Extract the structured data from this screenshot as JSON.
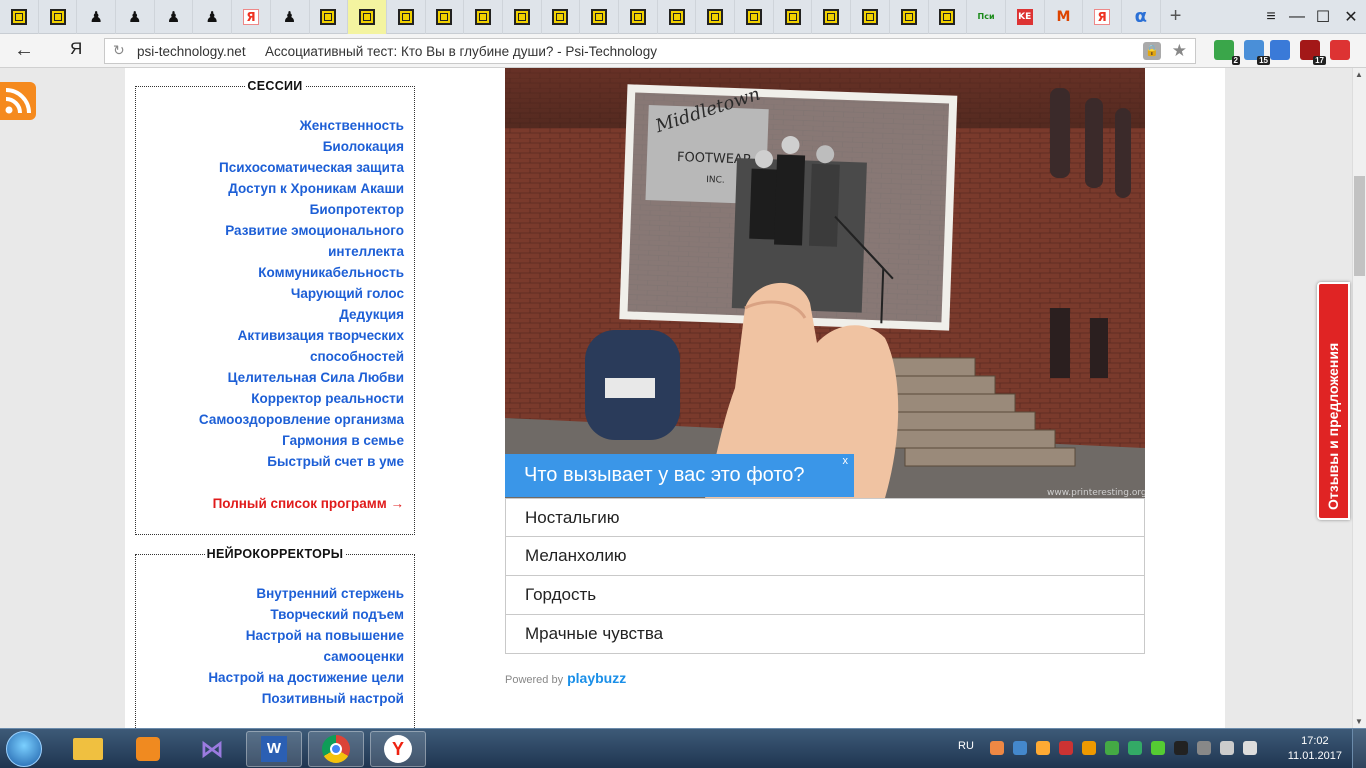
{
  "browser": {
    "tabs": [
      {
        "icon": "maze-icon"
      },
      {
        "icon": "maze-icon"
      },
      {
        "icon": "chess-piece-icon"
      },
      {
        "icon": "chess-piece-icon"
      },
      {
        "icon": "chess-piece-icon"
      },
      {
        "icon": "chess-piece-icon"
      },
      {
        "icon": "yandex-icon",
        "text": "Я"
      },
      {
        "icon": "chess-piece-icon"
      },
      {
        "icon": "maze-icon"
      },
      {
        "icon": "maze-icon",
        "active": true
      },
      {
        "icon": "maze-icon"
      },
      {
        "icon": "maze-icon"
      },
      {
        "icon": "maze-icon"
      },
      {
        "icon": "maze-icon"
      },
      {
        "icon": "maze-icon"
      },
      {
        "icon": "maze-icon"
      },
      {
        "icon": "maze-icon"
      },
      {
        "icon": "maze-icon"
      },
      {
        "icon": "maze-icon"
      },
      {
        "icon": "maze-icon"
      },
      {
        "icon": "maze-icon"
      },
      {
        "icon": "maze-icon"
      },
      {
        "icon": "maze-icon"
      },
      {
        "icon": "maze-icon"
      },
      {
        "icon": "maze-icon"
      },
      {
        "icon": "psi-icon",
        "text": "Пси"
      },
      {
        "icon": "ke-icon",
        "text": "KE"
      },
      {
        "icon": "m-icon",
        "text": "М"
      },
      {
        "icon": "yandex-icon",
        "text": "Я"
      },
      {
        "icon": "alpha-icon",
        "text": "α"
      }
    ],
    "new_tab_symbol": "+",
    "window_controls": {
      "menu": "≡",
      "minimize": "—",
      "maximize": "☐",
      "close": "✕"
    },
    "back_symbol": "←",
    "yandex_logo": "Я",
    "reload_symbol": "↻",
    "domain": "psi-technology.net",
    "title": "Ассоциативный тест: Кто Вы в глубине души? - Psi-Technology",
    "star_symbol": "★",
    "extensions": [
      {
        "name": "shield-extension-icon",
        "badge": "2",
        "color": "#3aa64a"
      },
      {
        "name": "people-extension-icon",
        "badge": "15",
        "color": "#4a8fd8"
      },
      {
        "name": "translate-extension-icon",
        "badge": "",
        "color": "#3a7ad8"
      },
      {
        "name": "ublock-extension-icon",
        "badge": "17",
        "color": "#a31818"
      },
      {
        "name": "save-extension-icon",
        "badge": "",
        "color": "#d33"
      }
    ],
    "menu_symbol": "≡"
  },
  "sidebar": {
    "sessions_title": "СЕССИИ",
    "sessions": [
      "Женственность",
      "Биолокация",
      "Психосоматическая защита",
      "Доступ к Хроникам Акаши",
      "Биопротектор",
      "Развитие эмоционального",
      "интеллекта",
      "Коммуникабельность",
      "Чарующий голос",
      "Дедукция",
      "Активизация творческих",
      "способностей",
      "Целительная Сила Любви",
      "Корректор реальности",
      "Самооздоровление организма",
      "Гармония в семье",
      "Быстрый счет в уме"
    ],
    "full_list": "Полный список программ →",
    "neuro_title": "НЕЙРОКОРРЕКТОРЫ",
    "neuro": [
      "Внутренний стержень",
      "Творческий подъем",
      "Настрой на повышение",
      "самооценки",
      "Настрой на достижение цели",
      "Позитивный настрой"
    ]
  },
  "quiz": {
    "photo_sign_lines": [
      "Middletown",
      "FOOTWEAR",
      "INC."
    ],
    "photo_credit": "www.printeresting.org",
    "question": "Что вызывает у вас это фото?",
    "close": "x",
    "answers": [
      "Ностальгию",
      "Меланхолию",
      "Гордость",
      "Мрачные чувства"
    ],
    "powered_by": "Powered by",
    "brand": "playbuzz"
  },
  "feedback_tab": "Отзывы и предложения",
  "taskbar": {
    "language": "RU",
    "time": "17:02",
    "date": "11.01.2017"
  }
}
